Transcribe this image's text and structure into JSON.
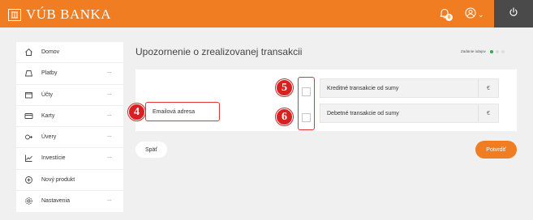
{
  "header": {
    "brand": "VÚB BANKA",
    "notification_count": "0",
    "user_caret": "⌄"
  },
  "sidebar": {
    "items": [
      {
        "label": "Domov",
        "icon": "home-icon",
        "dots": ""
      },
      {
        "label": "Platby",
        "icon": "payments-icon",
        "dots": "..."
      },
      {
        "label": "Účty",
        "icon": "wallet-icon",
        "dots": "..."
      },
      {
        "label": "Karty",
        "icon": "card-icon",
        "dots": "..."
      },
      {
        "label": "Úvery",
        "icon": "loan-icon",
        "dots": "..."
      },
      {
        "label": "Investície",
        "icon": "chart-icon",
        "dots": "..."
      },
      {
        "label": "Nový produkt",
        "icon": "plus-circle-icon",
        "dots": ""
      },
      {
        "label": "Nastavenia",
        "icon": "gear-icon",
        "dots": "..."
      }
    ]
  },
  "main": {
    "title": "Upozornenie o zrealizovanej transakcii",
    "strength_label": "Zadanie údajov"
  },
  "form": {
    "email_label": "Emailová adresa",
    "credit_label": "Kreditné transakcie od sumy",
    "debit_label": "Debetné transakcie od sumy",
    "currency": "€"
  },
  "markers": {
    "m4": "4",
    "m5": "5",
    "m6": "6"
  },
  "actions": {
    "back": "Späť",
    "confirm": "Potvrdiť"
  },
  "colors": {
    "brand_orange": "#f07d22",
    "marker_red": "#d82020",
    "status_green": "#21b04b"
  }
}
